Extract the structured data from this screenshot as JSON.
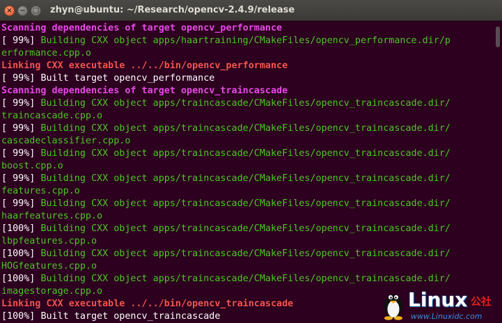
{
  "window": {
    "title": "zhyn@ubuntu: ~/Research/opencv-2.4.9/release",
    "close_label": "×",
    "minimize_label": "−",
    "maximize_label": "□"
  },
  "terminal": {
    "lines": [
      {
        "text": "Scanning dependencies of target opencv_performance",
        "color": "magenta"
      },
      {
        "prefix": "[ 99%] ",
        "text": "Building CXX object apps/haartraining/CMakeFiles/opencv_performance.dir/p",
        "color": "green"
      },
      {
        "text": "erformance.cpp.o",
        "color": "green"
      },
      {
        "text": "Linking CXX executable ../../bin/opencv_performance",
        "color": "red"
      },
      {
        "prefix": "[ 99%] ",
        "text": "Built target opencv_performance",
        "color": "white"
      },
      {
        "text": "Scanning dependencies of target opencv_traincascade",
        "color": "magenta"
      },
      {
        "prefix": "[ 99%] ",
        "text": "Building CXX object apps/traincascade/CMakeFiles/opencv_traincascade.dir/",
        "color": "green"
      },
      {
        "text": "traincascade.cpp.o",
        "color": "green"
      },
      {
        "prefix": "[ 99%] ",
        "text": "Building CXX object apps/traincascade/CMakeFiles/opencv_traincascade.dir/",
        "color": "green"
      },
      {
        "text": "cascadeclassifier.cpp.o",
        "color": "green"
      },
      {
        "prefix": "[ 99%] ",
        "text": "Building CXX object apps/traincascade/CMakeFiles/opencv_traincascade.dir/",
        "color": "green"
      },
      {
        "text": "boost.cpp.o",
        "color": "green"
      },
      {
        "prefix": "[ 99%] ",
        "text": "Building CXX object apps/traincascade/CMakeFiles/opencv_traincascade.dir/",
        "color": "green"
      },
      {
        "text": "features.cpp.o",
        "color": "green"
      },
      {
        "prefix": "[ 99%] ",
        "text": "Building CXX object apps/traincascade/CMakeFiles/opencv_traincascade.dir/",
        "color": "green"
      },
      {
        "text": "haarfeatures.cpp.o",
        "color": "green"
      },
      {
        "prefix": "[100%] ",
        "text": "Building CXX object apps/traincascade/CMakeFiles/opencv_traincascade.dir/",
        "color": "green"
      },
      {
        "text": "lbpfeatures.cpp.o",
        "color": "green"
      },
      {
        "prefix": "[100%] ",
        "text": "Building CXX object apps/traincascade/CMakeFiles/opencv_traincascade.dir/",
        "color": "green"
      },
      {
        "text": "HOGfeatures.cpp.o",
        "color": "green"
      },
      {
        "prefix": "[100%] ",
        "text": "Building CXX object apps/traincascade/CMakeFiles/opencv_traincascade.dir/",
        "color": "green"
      },
      {
        "text": "imagestorage.cpp.o",
        "color": "green"
      },
      {
        "text": "Linking CXX executable ../../bin/opencv_traincascade",
        "color": "red"
      },
      {
        "prefix": "[100%] ",
        "text": "Built target opencv_traincascade",
        "color": "white"
      }
    ]
  },
  "watermark": {
    "brand": "Linux",
    "cn_label": "公社",
    "url": "www.Linuxidc.com"
  },
  "colors": {
    "background": "#2c001e",
    "green": "#4ec628",
    "magenta": "#e64ae6",
    "red": "#f0554d",
    "white": "#ffffff"
  }
}
